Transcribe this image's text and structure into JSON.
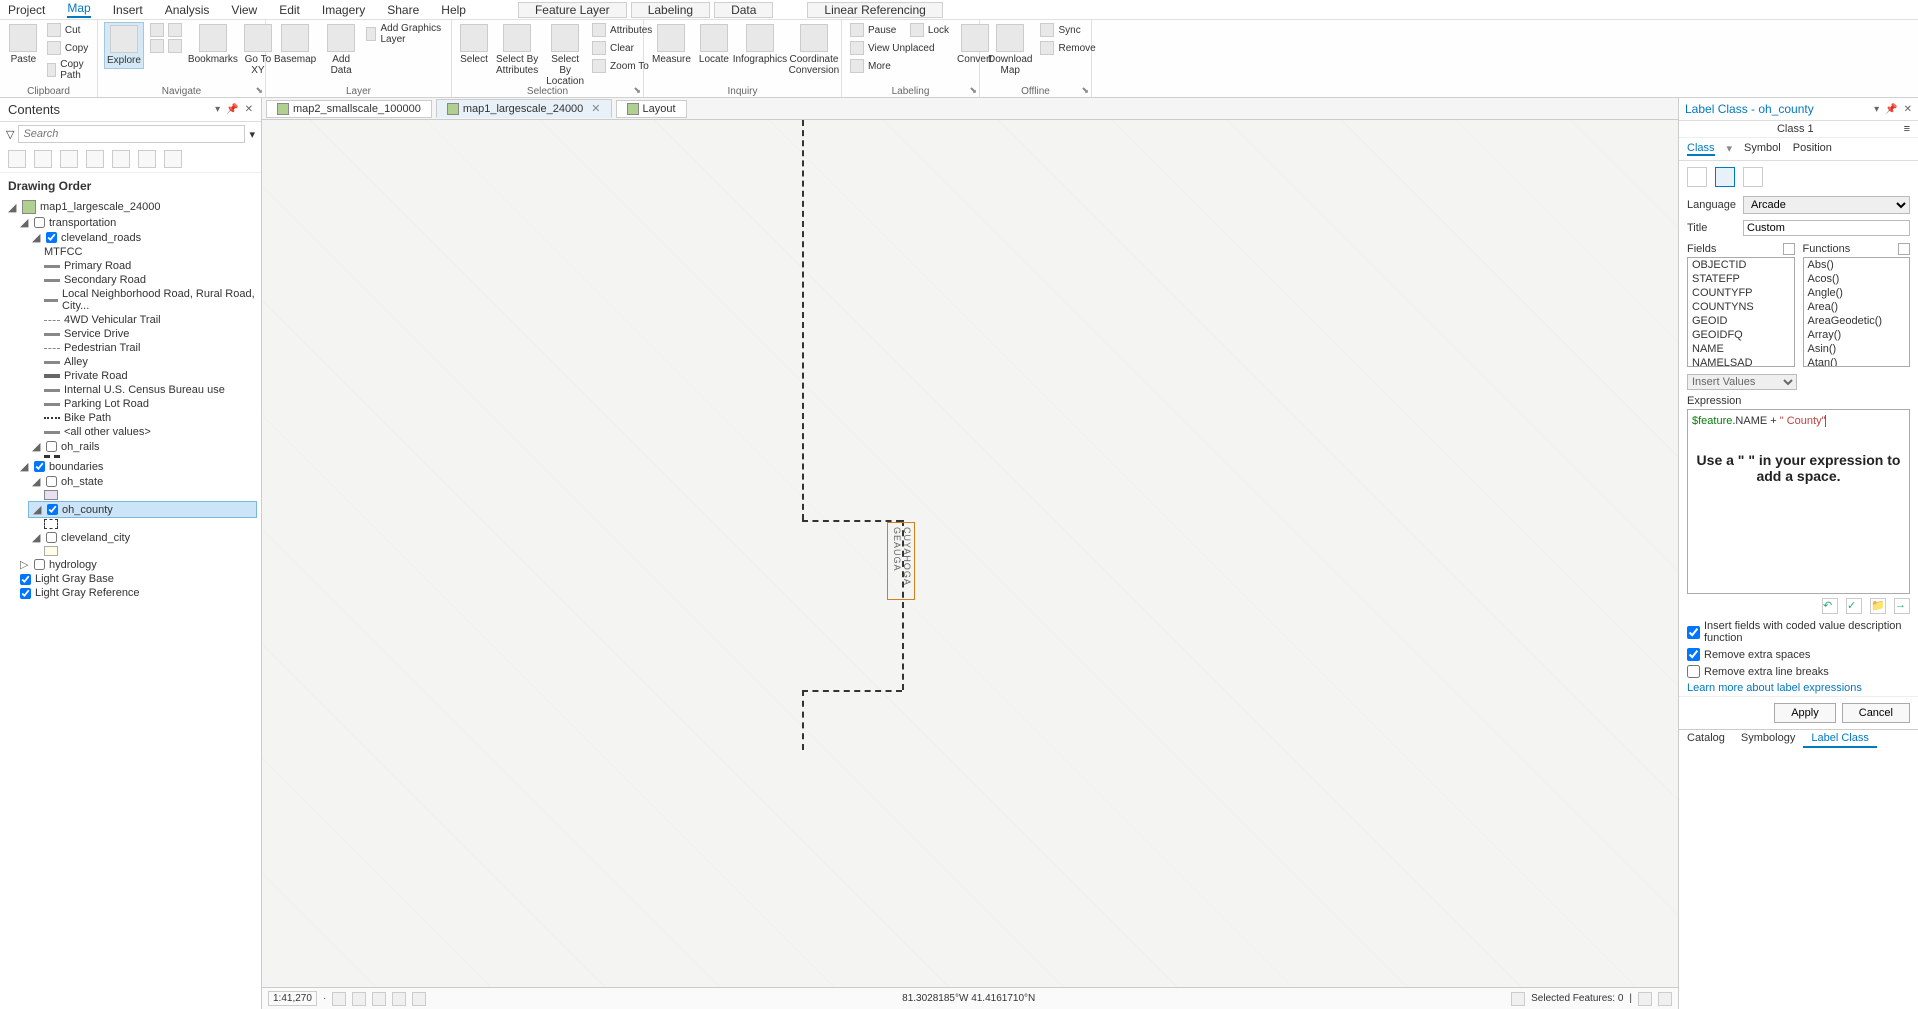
{
  "menu": {
    "items": [
      "Project",
      "Map",
      "Insert",
      "Analysis",
      "View",
      "Edit",
      "Imagery",
      "Share",
      "Help"
    ],
    "active": "Map",
    "context": [
      "Feature Layer",
      "Labeling",
      "Data"
    ],
    "context2": [
      "Linear Referencing"
    ]
  },
  "ribbon": {
    "clipboard": {
      "label": "Clipboard",
      "paste": "Paste",
      "cut": "Cut",
      "copy": "Copy",
      "copypath": "Copy Path"
    },
    "navigate": {
      "label": "Navigate",
      "explore": "Explore",
      "bookmarks": "Bookmarks",
      "goto": "Go To XY"
    },
    "layer": {
      "label": "Layer",
      "basemap": "Basemap",
      "adddata": "Add Data",
      "addgraphics": "Add Graphics Layer"
    },
    "selection": {
      "label": "Selection",
      "select": "Select",
      "byattr": "Select By Attributes",
      "byloc": "Select By Location",
      "attributes": "Attributes",
      "clear": "Clear",
      "zoomto": "Zoom To"
    },
    "inquiry": {
      "label": "Inquiry",
      "measure": "Measure",
      "locate": "Locate",
      "infographics": "Infographics",
      "coord": "Coordinate Conversion"
    },
    "labeling": {
      "label": "Labeling",
      "pause": "Pause",
      "lock": "Lock",
      "viewunplaced": "View Unplaced",
      "more": "More",
      "convert": "Convert"
    },
    "offline": {
      "label": "Offline",
      "download": "Download Map",
      "sync": "Sync",
      "remove": "Remove"
    }
  },
  "contents": {
    "title": "Contents",
    "search_placeholder": "Search",
    "drawing_order": "Drawing Order",
    "map_name": "map1_largescale_24000",
    "groups": {
      "transportation": "transportation",
      "cleveland_roads": "cleveland_roads",
      "mtfcc": "MTFCC",
      "roads": [
        "Primary Road",
        "Secondary Road",
        "Local Neighborhood Road, Rural Road, City...",
        "4WD Vehicular Trail",
        "Service Drive",
        "Pedestrian Trail",
        "Alley",
        "Private Road",
        "Internal U.S. Census Bureau use",
        "Parking Lot Road",
        "Bike Path",
        "<all other values>"
      ],
      "oh_rails": "oh_rails",
      "boundaries": "boundaries",
      "oh_state": "oh_state",
      "oh_county": "oh_county",
      "cleveland_city": "cleveland_city",
      "hydrology": "hydrology",
      "lgbase": "Light Gray Base",
      "lgref": "Light Gray Reference"
    }
  },
  "maptabs": {
    "tab1": "map2_smallscale_100000",
    "tab2": "map1_largescale_24000",
    "tab3": "Layout"
  },
  "maplabel": {
    "cuyahoga": "CUYAHOGA",
    "geauga": "GEAUGA"
  },
  "statusbar": {
    "scale": "1:41,270",
    "coords": "81.3028185°W 41.4161710°N",
    "selected": "Selected Features: 0"
  },
  "labelclass": {
    "title": "Label Class - oh_county",
    "classname": "Class 1",
    "tabs": [
      "Class",
      "Symbol",
      "Position"
    ],
    "language_label": "Language",
    "language": "Arcade",
    "title_label": "Title",
    "title_val": "Custom",
    "fields_label": "Fields",
    "functions_label": "Functions",
    "fields": [
      "OBJECTID",
      "STATEFP",
      "COUNTYFP",
      "COUNTYNS",
      "GEOID",
      "GEOIDFQ",
      "NAME",
      "NAMELSAD"
    ],
    "functions": [
      "Abs()",
      "Acos()",
      "Angle()",
      "Area()",
      "AreaGeodetic()",
      "Array()",
      "Asin()",
      "Atan()"
    ],
    "insert_values": "Insert Values",
    "expression_label": "Expression",
    "expr_feature": "$feature",
    "expr_name": ".NAME + ",
    "expr_str": "\" County\"",
    "hint": "Use a \" \" in your expression to add a space.",
    "chk1": "Insert fields with coded value description function",
    "chk2": "Remove extra spaces",
    "chk3": "Remove extra line breaks",
    "learn": "Learn more about label expressions",
    "apply": "Apply",
    "cancel": "Cancel",
    "bottom_tabs": [
      "Catalog",
      "Symbology",
      "Label Class"
    ]
  }
}
